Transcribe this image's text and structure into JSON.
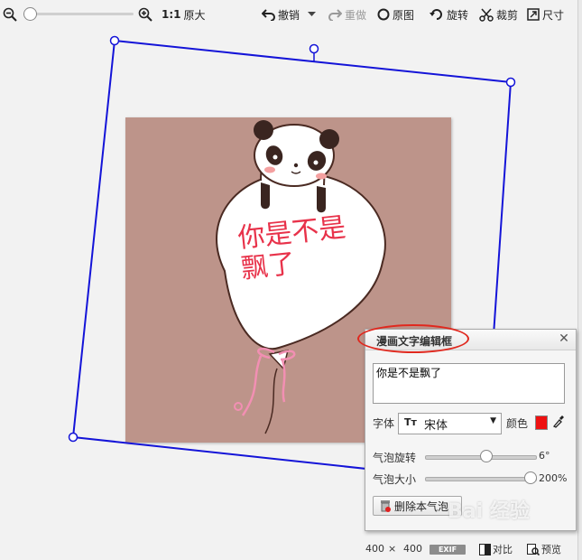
{
  "toolbar": {
    "zoom_level": 0,
    "actual_size_prefix": "1:1",
    "actual_size_label": "原大",
    "undo_label": "撤销",
    "redo_label": "重做",
    "original_label": "原图",
    "rotate_label": "旋转",
    "crop_label": "裁剪",
    "size_label": "尺寸"
  },
  "canvas": {
    "image_bg_color": "#bd948a",
    "frame_color": "#1414d8",
    "balloon_text": "你是不是\n飘了"
  },
  "dialog": {
    "title": "漫画文字编辑框",
    "text_value": "你是不是飘了",
    "font_label": "字体",
    "font_icon": "Tт",
    "font_value": "宋体",
    "color_label": "颜色",
    "color_value": "#ee1111",
    "rotate_label": "气泡旋转",
    "rotate_value": "6°",
    "rotate_fraction": 0.55,
    "size_label": "气泡大小",
    "size_value": "200%",
    "size_fraction": 1.0,
    "delete_label": "删除本气泡"
  },
  "status": {
    "width": "400",
    "times": "×",
    "height": "400",
    "exif_label": "EXIF",
    "compare_label": "对比",
    "preview_label": "预览"
  },
  "watermark": "Bai 经验"
}
